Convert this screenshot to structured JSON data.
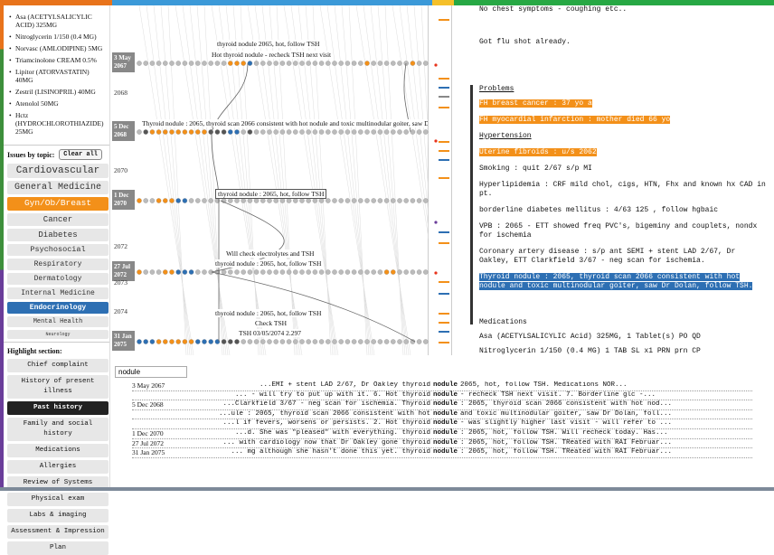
{
  "topbar_colors": [
    "#e8731b",
    "#3b99d8",
    "#f5c02a",
    "#27a844"
  ],
  "medications": [
    "Asa (ACETYLSALICYLIC ACID) 325MG",
    "Nitroglycerin 1/150 (0.4 MG)",
    "Norvasc (AMLODIPINE) 5MG",
    "Triamcinolone CREAM 0.5%",
    "Lipitor (ATORVASTATIN) 40MG",
    "Zestril (LISINOPRIL) 40MG",
    "Atenolol 50MG",
    "Hctz (HYDROCHLOROTHIAZIDE) 25MG"
  ],
  "issues_heading": "Issues by topic:",
  "clear_all": "Clear all",
  "topics": [
    {
      "label": "Cardiovascular",
      "size": 11,
      "state": ""
    },
    {
      "label": "General Medicine",
      "size": 10,
      "state": ""
    },
    {
      "label": "Gyn/Ob/Breast",
      "size": 9.5,
      "state": "sel-orange"
    },
    {
      "label": "Cancer",
      "size": 9,
      "state": ""
    },
    {
      "label": "Diabetes",
      "size": 9,
      "state": ""
    },
    {
      "label": "Psychosocial",
      "size": 8.5,
      "state": ""
    },
    {
      "label": "Respiratory",
      "size": 8,
      "state": ""
    },
    {
      "label": "Dermatology",
      "size": 8,
      "state": ""
    },
    {
      "label": "Internal Medicine",
      "size": 8,
      "state": ""
    },
    {
      "label": "Endocrinology",
      "size": 8,
      "state": "sel-blue"
    },
    {
      "label": "Mental Health",
      "size": 7,
      "state": ""
    },
    {
      "label": "Neurology",
      "size": 5,
      "state": ""
    }
  ],
  "highlight_heading": "Highlight section:",
  "sections": [
    {
      "label": "Chief complaint",
      "active": false
    },
    {
      "label": "History of present illness",
      "active": false
    },
    {
      "label": "Past history",
      "active": true
    },
    {
      "label": "Family and social history",
      "active": false
    },
    {
      "label": "Medications",
      "active": false
    },
    {
      "label": "Allergies",
      "active": false
    },
    {
      "label": "Review of Systems",
      "active": false
    },
    {
      "label": "Physical exam",
      "active": false
    },
    {
      "label": "Labs & imaging",
      "active": false
    },
    {
      "label": "Assessment & Impression",
      "active": false
    },
    {
      "label": "Plan",
      "active": false
    }
  ],
  "timeline": {
    "visits": [
      {
        "line1": "3 May",
        "line2": "2067"
      },
      {
        "line1": "5 Dec",
        "line2": "2068"
      },
      {
        "line1": "1 Dec",
        "line2": "2070"
      },
      {
        "line1": "27 Jul",
        "line2": "2072"
      },
      {
        "line1": "31 Jan",
        "line2": "2075"
      }
    ],
    "years": [
      "2068",
      "2070",
      "2072",
      "2073",
      "2074"
    ],
    "notes": [
      "thyroid nodule 2065, hot, follow TSH",
      "Hot thyroid nodule - recheck TSH next visit",
      "Thyroid nodule : 2065, thyroid scan 2066 consistent with hot nodule and toxic multinodular goiter, saw Dr",
      "thyroid nodule : 2065, hot, follow TSH",
      "Will check electrolytes and TSH",
      "thyroid nodule : 2065, hot, follow TSH",
      "thyroid nodule : 2065, hot, follow TSH",
      "Check TSH",
      "TSH 03/05/2074 2.297"
    ]
  },
  "doc": {
    "l1": "No chest symptoms - coughing etc..",
    "l2": "Got flu shot already.",
    "problems": "Problems",
    "fh1": "FH breast cancer : 37 yo a",
    "fh2": "FH myocardial infarction : mother died 66 yo",
    "htn": "Hypertension",
    "ut": "Uterine fibroids : u/s 2062",
    "smoke": "Smoking : quit 2/67 s/p MI",
    "hyper": "Hyperlipidemia : CRF mild chol, cigs, HTN, Fhx and known hx CAD in pt.",
    "dm": "borderline diabetes mellitus : 4/63 125 , follow hgbaic",
    "vpb": "VPB : 2065 - ETT showed freq PVC's, bigeminy and couplets, nondx for ischemia",
    "cad": "Coronary artery disease : s/p ant SEMI + stent LAD 2/67, Dr Oakley, ETT Clarkfield 3/67 - neg scan for ischemia.",
    "thy": "Thyroid nodule : 2065, thyroid scan 2066 consistent with hot nodule and toxic multinodular goiter, saw Dr Dolan, follow TSH.",
    "meds": "Medications",
    "asa": "Asa (ACETYLSALICYLIC Acid) 325MG, 1 Tablet(s) PO QD",
    "nitro": "Nitroglycerin 1/150 (0.4 MG) 1 TAB SL x1 PRN prn CP"
  },
  "search_value": "nodule",
  "kwic": [
    {
      "date": "3 May 2067",
      "left": "...EMI + stent LAD 2/67, Dr Oakley thyroid",
      "hit": "nodule",
      "right": "2065, hot, follow TSH. Medications NOR..."
    },
    {
      "date": "",
      "left": "... - will try to put up with it. 6. Hot thyroid",
      "hit": "nodule",
      "right": "- recheck TSH next visit. 7. Borderline glc -..."
    },
    {
      "date": "5 Dec 2068",
      "left": "...Clarkfield 3/67 - neg scan for ischemia. Thyroid",
      "hit": "nodule",
      "right": ": 2065, thyroid scan 2066 consistent with hot nod..."
    },
    {
      "date": "",
      "left": "...ule : 2065, thyroid scan 2066 consistent with hot",
      "hit": "nodule",
      "right": "and toxic multinodular goiter, saw Dr Dolan, foll..."
    },
    {
      "date": "",
      "left": "...l if fevers, worsens or persists. 2. Hot thyroid",
      "hit": "nodule",
      "right": "- was slightly higher last visit - will refer to ..."
    },
    {
      "date": "1 Dec 2070",
      "left": "...d. She was \"pleased\" with everything. thyroid",
      "hit": "nodule",
      "right": ": 2065, hot, follow TSH. Will recheck today. Has..."
    },
    {
      "date": "27 Jul 2072",
      "left": "... with cardiology now that Dr Oakley gone thyroid",
      "hit": "nodule",
      "right": ": 2065, hot, follow TSH. TReated with RAI Februar..."
    },
    {
      "date": "31 Jan 2075",
      "left": "... mg although she hasn't done this yet. thyroid",
      "hit": "nodule",
      "right": ": 2065, hot, follow TSH. TReated with RAI Februar..."
    }
  ]
}
